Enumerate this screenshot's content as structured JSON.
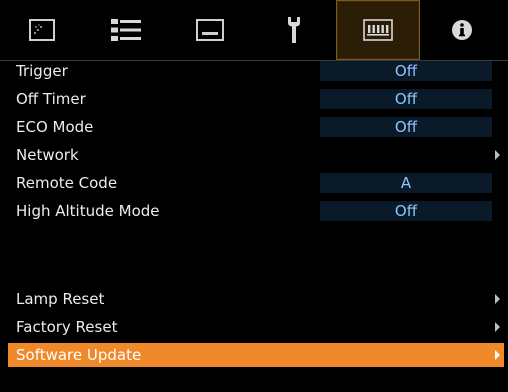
{
  "tabs": [
    {
      "icon": "picture-icon"
    },
    {
      "icon": "settings-list-icon"
    },
    {
      "icon": "screen-icon"
    },
    {
      "icon": "wrench-icon"
    },
    {
      "icon": "projector-panel-icon"
    },
    {
      "icon": "info-icon"
    }
  ],
  "active_tab_index": 4,
  "menu": {
    "items": [
      {
        "label": "Trigger",
        "value": "Off"
      },
      {
        "label": "Off Timer",
        "value": "Off"
      },
      {
        "label": "ECO Mode",
        "value": "Off"
      },
      {
        "label": "Network",
        "submenu": true
      },
      {
        "label": "Remote Code",
        "value": "A"
      },
      {
        "label": "High Altitude Mode",
        "value": "Off"
      },
      {
        "label": "Lamp Reset",
        "submenu": true
      },
      {
        "label": "Factory Reset",
        "submenu": true
      },
      {
        "label": "Software Update",
        "submenu": true,
        "selected": true
      }
    ]
  },
  "colors": {
    "background": "#000000",
    "selected_row": "#f0892a",
    "value_box": "#0b1a28",
    "value_text": "#8fc4ff",
    "active_tab": "#2a1c05"
  }
}
